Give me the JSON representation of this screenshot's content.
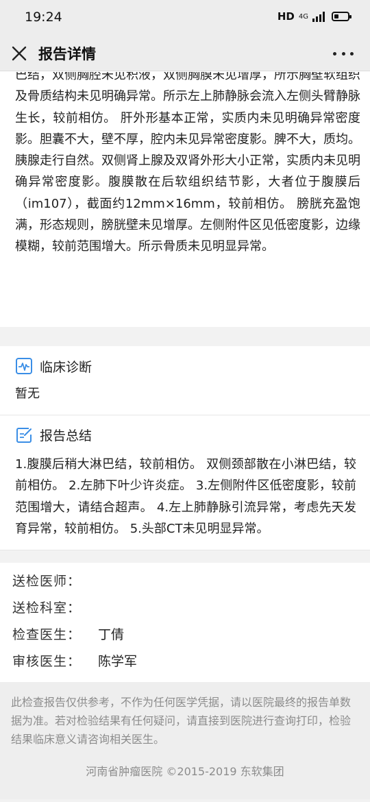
{
  "status_bar": {
    "time": "19:24",
    "network": "HD",
    "network_type": "4G"
  },
  "nav": {
    "title": "报告详情",
    "close_icon": "close-icon",
    "more_icon": "more-icon"
  },
  "findings": {
    "text": "巴结，双侧胸腔未见积液，双侧胸膜未见增厚，所示胸壁软组织及骨质结构未见明确异常。所示左上肺静脉会流入左侧头臂静脉生长，较前相仿。 肝外形基本正常，实质内未见明确异常密度影。胆囊不大，壁不厚，腔内未见异常密度影。脾不大，质均。胰腺走行自然。双侧肾上腺及双肾外形大小正常，实质内未见明确异常密度影。腹膜散在后软组织结节影，大者位于腹膜后（im107），截面约12mm×16mm，较前相仿。 膀胱充盈饱满，形态规则，膀胱壁未见增厚。左侧附件区见低密度影，边缘模糊，较前范围增大。所示骨质未见明显异常。"
  },
  "clinical_diagnosis": {
    "title": "临床诊断",
    "icon": "pulse-icon",
    "body": "暂无"
  },
  "summary": {
    "title": "报告总结",
    "icon": "edit-icon",
    "body": "1.腹膜后稍大淋巴结，较前相仿。 双侧颈部散在小淋巴结，较前相仿。 2.左肺下叶少许炎症。 3.左侧附件区低密度影，较前范围增大，请结合超声。 4.左上肺静脉引流异常，考虑先天发育异常，较前相仿。 5.头部CT未见明显异常。"
  },
  "people": [
    {
      "label": "送检医师：",
      "value": ""
    },
    {
      "label": "送检科室：",
      "value": ""
    },
    {
      "label": "检查医生：",
      "value": "丁倩"
    },
    {
      "label": "审核医生：",
      "value": "陈学军"
    }
  ],
  "disclaimer": "此检查报告仅供参考，不作为任何医学凭据，请以医院最终的报告单数据为准。若对检验结果有任何疑问，请直接到医院进行查询打印，检验结果临床意义请咨询相关医生。",
  "footer": "河南省肿瘤医院 ©2015-2019 东软集团",
  "colors": {
    "accent_icon": "#3a8ee6",
    "nav_bg": "#ededed",
    "page_bg": "#f2f2f2",
    "muted_text": "#8c8c8c"
  }
}
